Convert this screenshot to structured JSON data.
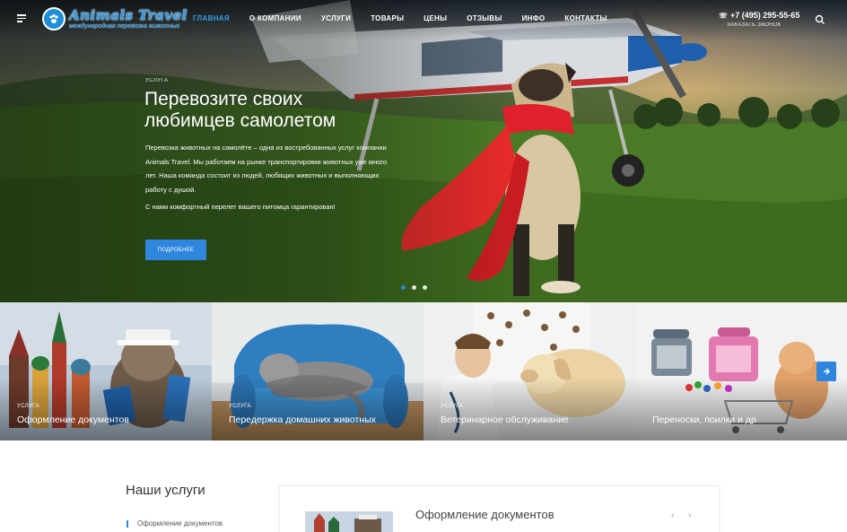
{
  "header": {
    "logo_title": "Animals Travel",
    "logo_subtitle": "международная перевозка животных",
    "nav": [
      "Главная",
      "О компании",
      "Услуги",
      "Товары",
      "Цены",
      "Отзывы",
      "Инфо",
      "Контакты"
    ],
    "active_nav_index": 0,
    "phone": "+7 (495) 295-55-65",
    "callback": "Заказать звонок",
    "accent_color": "#2e86de"
  },
  "hero": {
    "tag": "Услуга",
    "title": "Перевозите своих любимцев самолетом",
    "description": "Перевозка животных на самолёте – одна из востребованных услуг компании Animals Travel. Мы работаем на рынке транспортировки животных уже много лет. Наша команда состоит из людей, любящих животных и выполняющих работу с душой.",
    "note": "С нами комфортный перелет вашего питомца гарантирован!",
    "button": "Подробнее",
    "slides_total": 3,
    "active_slide_index": 0
  },
  "tiles": [
    {
      "tag": "Услуга",
      "title": "Оформление документов"
    },
    {
      "tag": "Услуга",
      "title": "Передержка домашних животных"
    },
    {
      "tag": "Услуга",
      "title": "Ветеринарное обслуживание"
    },
    {
      "tag": "",
      "title": "Переноски, поилки и др"
    }
  ],
  "services": {
    "heading": "Наши услуги",
    "side_items": [
      "Оформление документов"
    ],
    "card_title": "Оформление документов"
  }
}
